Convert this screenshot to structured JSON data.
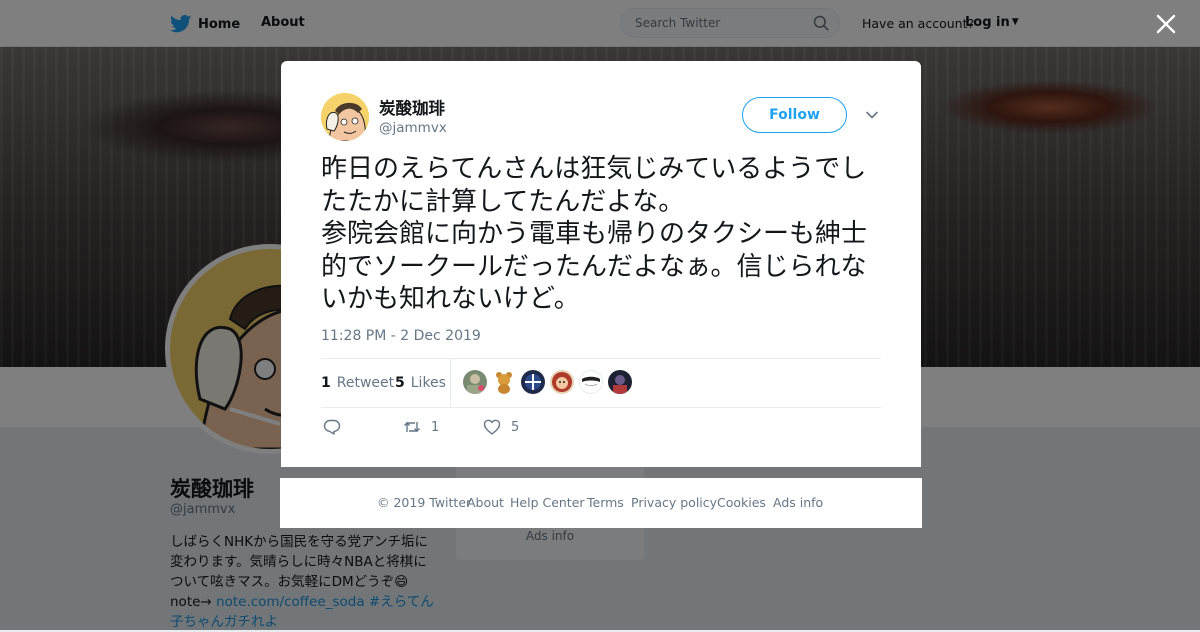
{
  "nav": {
    "home_label": "Home",
    "about_label": "About",
    "search_placeholder": "Search Twitter",
    "have_account": "Have an account?",
    "login_label": "Log in"
  },
  "profile": {
    "name": "炭酸珈琲",
    "handle": "@jammvx",
    "bio_text": "しばらくNHKから国民を守る党アンチ垢に変わります。気晴らしに時々NBAと将棋について呟きマス。お気軽にDMどうぞ😄note→ ",
    "bio_link": "note.com/coffee_soda",
    "bio_hashtag": " #えらてん子ちゃんガチれよ",
    "side_ads": "Ads info"
  },
  "tweet": {
    "name": "炭酸珈琲",
    "handle": "@jammvx",
    "follow_label": "Follow",
    "text": "昨日のえらてんさんは狂気じみているようでしたたかに計算してたんだよな。\n参院会館に向かう電車も帰りのタクシーも紳士的でソークールだったんだよなぁ。信じられないかも知れないけど。",
    "timestamp": "11:28 PM - 2 Dec 2019",
    "retweets_count": "1",
    "retweets_label": "Retweet",
    "likes_count": "5",
    "likes_label": "Likes",
    "action_retweet_count": "1",
    "action_like_count": "5"
  },
  "footer": {
    "copyright": "© 2019 Twitter",
    "about": "About",
    "help": "Help Center",
    "terms": "Terms",
    "privacy": "Privacy policy",
    "cookies": "Cookies",
    "ads": "Ads info"
  },
  "colors": {
    "accent": "#1da1f2",
    "text": "#14171a",
    "muted": "#657786"
  },
  "icons": [
    "twitter-bird-icon",
    "search-icon",
    "close-icon",
    "chevron-down-icon",
    "reply-icon",
    "retweet-icon",
    "heart-icon"
  ]
}
